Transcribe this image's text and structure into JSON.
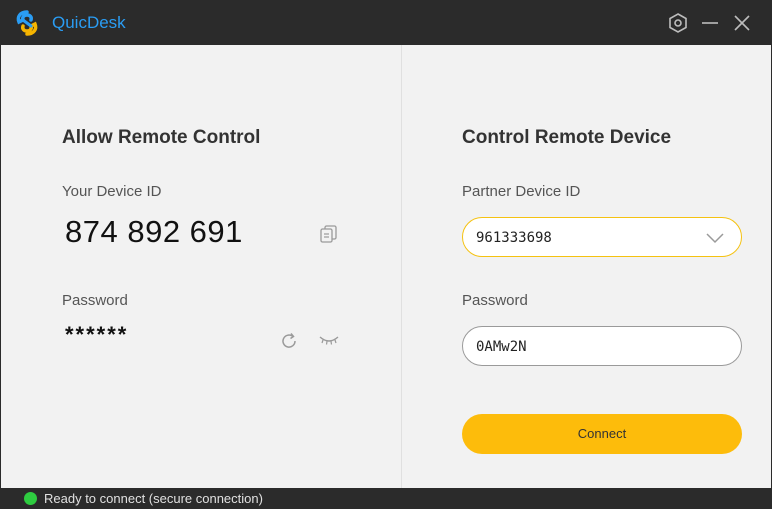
{
  "app": {
    "title": "QuicDesk",
    "brand_color": "#2a9df4"
  },
  "titlebar": {
    "icons": [
      "settings-icon",
      "minimize-icon",
      "close-icon"
    ]
  },
  "allow": {
    "heading": "Allow Remote Control",
    "device_id_label": "Your Device ID",
    "device_id": "874 892 691",
    "password_label": "Password",
    "password_masked": "******",
    "icons": [
      "copy-icon",
      "refresh-icon",
      "eye-hidden-icon"
    ]
  },
  "control": {
    "heading": "Control Remote Device",
    "partner_label": "Partner Device ID",
    "partner_value": "961333698",
    "password_label": "Password",
    "password_value": "0AMw2N",
    "connect_label": "Connect",
    "accent_color": "#fdbc0b"
  },
  "status": {
    "text": "Ready to connect (secure connection)",
    "color": "#2ecc40"
  }
}
